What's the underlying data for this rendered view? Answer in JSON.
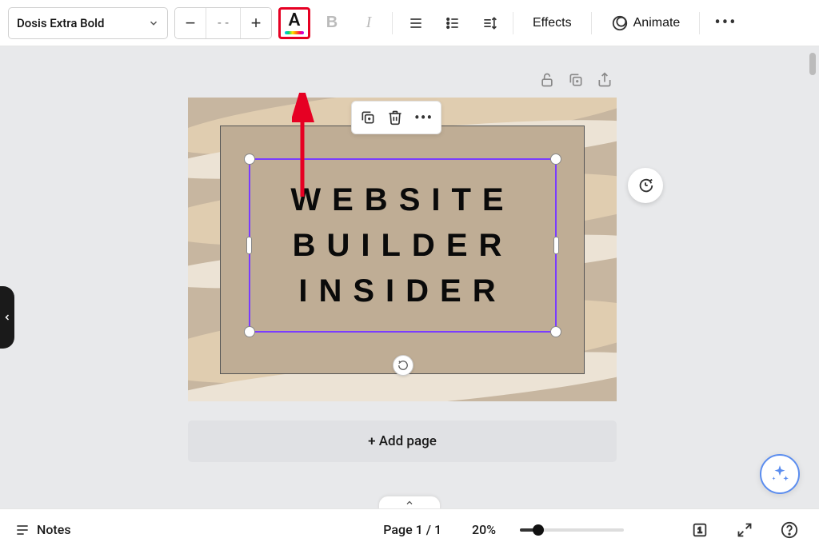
{
  "toolbar": {
    "font_name": "Dosis Extra Bold",
    "size_placeholder": "- -",
    "effects_label": "Effects",
    "animate_label": "Animate"
  },
  "canvas": {
    "text_line1": "WEBSITE",
    "text_line2": "BUILDER",
    "text_line3": "INSIDER",
    "add_page_label": "+ Add page"
  },
  "bottombar": {
    "notes_label": "Notes",
    "page_indicator": "Page 1 / 1",
    "zoom_label": "20%",
    "grid_count": "1"
  }
}
